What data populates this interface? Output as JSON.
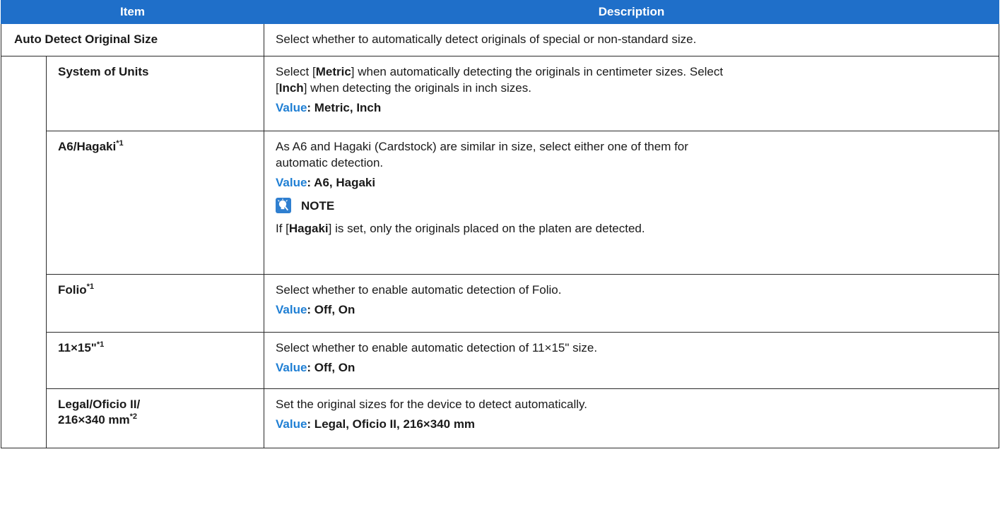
{
  "header": {
    "item": "Item",
    "description": "Description"
  },
  "rows": [
    {
      "item": "Auto Detect Original Size",
      "desc": "Select whether to automatically detect originals of special or non-standard size."
    },
    {
      "item": "System of Units",
      "desc_line1_a": "Select [",
      "desc_line1_b": "Metric",
      "desc_line1_c": "] when automatically detecting the originals in centimeter sizes. Select",
      "desc_line2_a": "[",
      "desc_line2_b": "Inch",
      "desc_line2_c": "] when detecting the originals in inch sizes.",
      "value_label": "Value",
      "value_text": ": Metric, Inch"
    },
    {
      "item": "A6/Hagaki",
      "sup": "*1",
      "desc_line1": "As A6 and Hagaki (Cardstock) are similar in size, select either one of them for",
      "desc_line2": "automatic detection.",
      "value_label": "Value",
      "value_text": ": A6, Hagaki",
      "note_title": "NOTE",
      "note_a": "If [",
      "note_b": "Hagaki",
      "note_c": "] is set, only the originals placed on the platen are detected."
    },
    {
      "item": "Folio",
      "sup": "*1",
      "desc": "Select whether to enable automatic detection of Folio.",
      "value_label": "Value",
      "value_text": ": Off, On"
    },
    {
      "item": "11×15\"",
      "sup": "*1",
      "desc": "Select whether to enable automatic detection of 11×15\" size.",
      "value_label": "Value",
      "value_text": ": Off, On"
    },
    {
      "item_line1": "Legal/Oficio II/",
      "item_line2": "216×340 mm",
      "sup": "*2",
      "desc": "Set the original sizes for the device to detect automatically.",
      "value_label": "Value",
      "value_text": ": Legal, Oficio II, 216×340 mm"
    }
  ],
  "colors": {
    "header_bg": "#1f6fc9",
    "value_label": "#1f7fd4",
    "note_icon": "#2f7fd0"
  },
  "icons": {
    "note": "lightbulb-icon"
  }
}
